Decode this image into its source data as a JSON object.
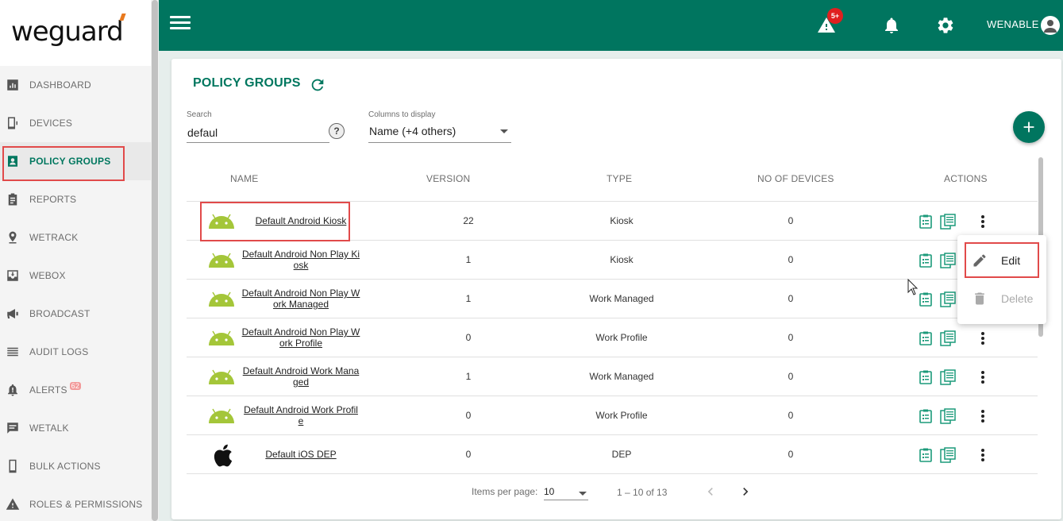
{
  "app": {
    "logo_text": "weguard",
    "user": "WENABLE",
    "alerts_badge": "5+"
  },
  "sidebar": {
    "items": [
      {
        "label": "DASHBOARD",
        "icon": "dashboard-icon"
      },
      {
        "label": "DEVICES",
        "icon": "devices-icon"
      },
      {
        "label": "POLICY GROUPS",
        "icon": "policy-groups-icon",
        "active": true
      },
      {
        "label": "REPORTS",
        "icon": "reports-icon"
      },
      {
        "label": "WETRACK",
        "icon": "location-pin-icon"
      },
      {
        "label": "WEBOX",
        "icon": "inbox-download-icon"
      },
      {
        "label": "BROADCAST",
        "icon": "megaphone-icon"
      },
      {
        "label": "AUDIT LOGS",
        "icon": "list-lines-icon"
      },
      {
        "label": "ALERTS",
        "icon": "alert-bell-icon",
        "badge": "62"
      },
      {
        "label": "WETALK",
        "icon": "chat-icon"
      },
      {
        "label": "BULK ACTIONS",
        "icon": "phone-icon"
      },
      {
        "label": "ROLES & PERMISSIONS",
        "icon": "warning-icon"
      }
    ]
  },
  "page": {
    "title": "POLICY GROUPS",
    "search": {
      "label": "Search",
      "value": "defaul"
    },
    "columns_select": {
      "label": "Columns to display",
      "value": "Name (+4 others)"
    }
  },
  "table": {
    "headers": {
      "name": "NAME",
      "version": "VERSION",
      "type": "TYPE",
      "devices": "NO OF DEVICES",
      "actions": "ACTIONS"
    },
    "rows": [
      {
        "name": "Default Android Kiosk",
        "version": "22",
        "type": "Kiosk",
        "devices": "0",
        "platform": "android"
      },
      {
        "name": "Default Android Non Play Kiosk",
        "version": "1",
        "type": "Kiosk",
        "devices": "0",
        "platform": "android"
      },
      {
        "name": "Default Android Non Play Work Managed",
        "version": "1",
        "type": "Work Managed",
        "devices": "0",
        "platform": "android"
      },
      {
        "name": "Default Android Non Play Work Profile",
        "version": "0",
        "type": "Work Profile",
        "devices": "0",
        "platform": "android"
      },
      {
        "name": "Default Android Work Managed",
        "version": "1",
        "type": "Work Managed",
        "devices": "0",
        "platform": "android"
      },
      {
        "name": "Default Android Work Profile",
        "version": "0",
        "type": "Work Profile",
        "devices": "0",
        "platform": "android"
      },
      {
        "name": "Default iOS DEP",
        "version": "0",
        "type": "DEP",
        "devices": "0",
        "platform": "apple"
      }
    ]
  },
  "pager": {
    "items_per_page_label": "Items per page:",
    "items_per_page": "10",
    "range": "1 – 10 of 13"
  },
  "context_menu": {
    "edit": "Edit",
    "delete": "Delete"
  },
  "colors": {
    "brand": "#00755f",
    "highlight": "#e14a4a"
  }
}
